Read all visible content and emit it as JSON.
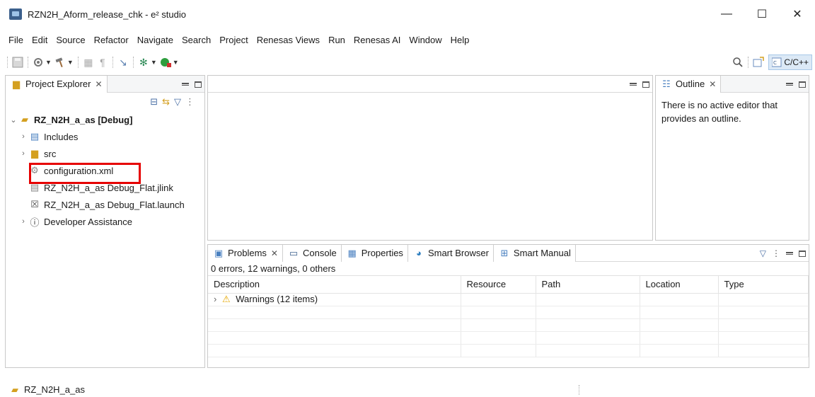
{
  "window": {
    "title": "RZN2H_Aform_release_chk - e² studio",
    "minimize": "—",
    "maximize": "☐",
    "close": "✕"
  },
  "menubar": [
    "File",
    "Edit",
    "Source",
    "Refactor",
    "Navigate",
    "Search",
    "Project",
    "Renesas Views",
    "Run",
    "Renesas AI",
    "Window",
    "Help"
  ],
  "toolbar": {
    "perspective_label": "C/C++"
  },
  "project_explorer": {
    "tab_label": "Project Explorer",
    "tree": [
      {
        "label": "RZ_N2H_a_as [Debug]",
        "icon": "project-icon",
        "expanded": true
      },
      {
        "label": "Includes",
        "icon": "includes-icon"
      },
      {
        "label": "src",
        "icon": "folder-icon"
      },
      {
        "label": "configuration.xml",
        "icon": "gear-icon"
      },
      {
        "label": "RZ_N2H_a_as Debug_Flat.jlink",
        "icon": "file-icon"
      },
      {
        "label": "RZ_N2H_a_as Debug_Flat.launch",
        "icon": "launch-icon"
      },
      {
        "label": "Developer Assistance",
        "icon": "help-icon"
      }
    ]
  },
  "outline": {
    "tab_label": "Outline",
    "message": "There is no active editor that provides an outline."
  },
  "bottom_panel": {
    "tabs": [
      "Problems",
      "Console",
      "Properties",
      "Smart Browser",
      "Smart Manual"
    ],
    "summary": "0 errors, 12 warnings, 0 others",
    "columns": [
      "Description",
      "Resource",
      "Path",
      "Location",
      "Type"
    ],
    "rows": [
      {
        "description": "Warnings (12 items)"
      }
    ]
  },
  "statusbar": {
    "project": "RZ_N2H_a_as"
  },
  "colors": {
    "highlight": "#e60000",
    "accent": "#3b5f8c"
  }
}
